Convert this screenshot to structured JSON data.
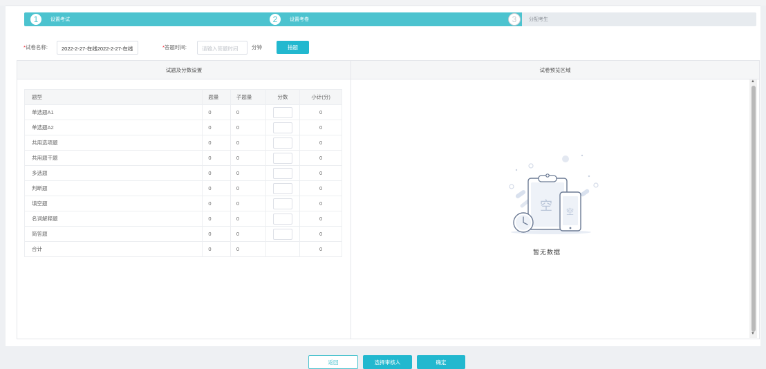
{
  "steps": [
    {
      "num": "1",
      "label": "设置考试"
    },
    {
      "num": "2",
      "label": "设置考卷"
    },
    {
      "num": "3",
      "label": "分配考生"
    }
  ],
  "form": {
    "name_label": "试卷名称:",
    "name_value": "2022-2-27-在线2022-2-27-在线",
    "time_label": "答题时间:",
    "time_placeholder": "请输入答题时间",
    "time_unit": "分钟",
    "draw_button": "抽题",
    "required_mark": "*"
  },
  "left_panel": {
    "title": "试题及分数设置",
    "columns": [
      "题型",
      "题量",
      "子题量",
      "分数",
      "小计(分)"
    ],
    "rows": [
      {
        "type": "单选题A1",
        "count": "0",
        "sub": "0",
        "subtotal": "0"
      },
      {
        "type": "单选题A2",
        "count": "0",
        "sub": "0",
        "subtotal": "0"
      },
      {
        "type": "共用选项题",
        "count": "0",
        "sub": "0",
        "subtotal": "0"
      },
      {
        "type": "共用题干题",
        "count": "0",
        "sub": "0",
        "subtotal": "0"
      },
      {
        "type": "多选题",
        "count": "0",
        "sub": "0",
        "subtotal": "0"
      },
      {
        "type": "判断题",
        "count": "0",
        "sub": "0",
        "subtotal": "0"
      },
      {
        "type": "填空题",
        "count": "0",
        "sub": "0",
        "subtotal": "0"
      },
      {
        "type": "名词解释题",
        "count": "0",
        "sub": "0",
        "subtotal": "0"
      },
      {
        "type": "简答题",
        "count": "0",
        "sub": "0",
        "subtotal": "0"
      }
    ],
    "total": {
      "type": "合计",
      "count": "0",
      "sub": "0",
      "subtotal": "0"
    }
  },
  "right_panel": {
    "title": "试卷预览区域",
    "empty_text": "暂无数据",
    "empty_glyph": "空"
  },
  "buttons": {
    "back": "返回",
    "select_reviewer": "选择审核人",
    "confirm": "确定"
  },
  "colors": {
    "accent": "#4cc3cf",
    "button": "#22b8cf",
    "required": "#f5222d"
  }
}
